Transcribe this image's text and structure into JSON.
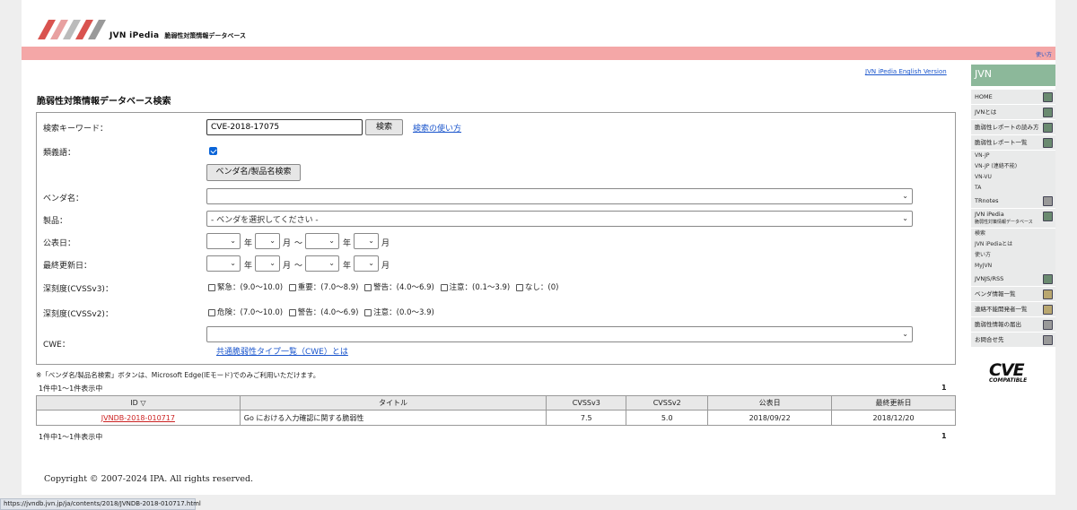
{
  "header": {
    "logo_name": "JVN iPedia",
    "logo_subtitle": "脆弱性対策情報データベース",
    "usage_link": "使い方",
    "english_link": "JVN iPedia English Version"
  },
  "search": {
    "section_title": "脆弱性対策情報データベース検索",
    "keyword_label": "検索キーワード：",
    "keyword_value": "CVE-2018-17075",
    "search_button": "検索",
    "howto_link": "検索の使い方",
    "synonym_label": "類義語：",
    "synonym_checked": true,
    "vendor_product_button": "ベンダ名/製品名検索",
    "vendor_label": "ベンダ名：",
    "vendor_value": "",
    "product_label": "製品：",
    "product_value": "- ベンダを選択してください -",
    "published_label": "公表日：",
    "updated_label": "最終更新日：",
    "unit_year": "年",
    "unit_month": "月",
    "range_sep": "〜",
    "cvss3_label": "深刻度(CVSSv3)：",
    "cvss3_options": [
      "緊急：(9.0〜10.0)",
      "重要：(7.0〜8.9)",
      "警告：(4.0〜6.9)",
      "注意：(0.1〜3.9)",
      "なし：(0)"
    ],
    "cvss2_label": "深刻度(CVSSv2)：",
    "cvss2_options": [
      "危険：(7.0〜10.0)",
      "警告：(4.0〜6.9)",
      "注意：(0.0〜3.9)"
    ],
    "cwe_label": "CWE：",
    "cwe_value": "",
    "cwe_link": "共通脆弱性タイプ一覧（CWE）とは"
  },
  "results": {
    "note": "※「ベンダ名/製品名検索」ボタンは、Microsoft Edge(IEモード)でのみご利用いただけます。",
    "count_text": "1件中1〜1件表示中",
    "page_number": "1",
    "columns": [
      "ID ▽",
      "タイトル",
      "CVSSv3",
      "CVSSv2",
      "公表日",
      "最終更新日"
    ],
    "rows": [
      [
        "JVNDB-2018-010717",
        "Go における入力確認に関する脆弱性",
        "7.5",
        "5.0",
        "2018/09/22",
        "2018/12/20"
      ]
    ]
  },
  "footer": {
    "copyright": "Copyright © 2007-2024 IPA. All rights reserved."
  },
  "sidebar": {
    "head": "JVN",
    "items": [
      {
        "label": "HOME",
        "icon": "home-icon",
        "sub": false
      },
      {
        "label": "JVNとは",
        "icon": "info-icon",
        "sub": false
      },
      {
        "label": "脆弱性レポートの読み方",
        "icon": "document-icon",
        "sub": false
      },
      {
        "label": "脆弱性レポート一覧",
        "icon": "list-icon",
        "sub": false
      },
      {
        "label": "VN-JP",
        "sub": true
      },
      {
        "label": "VN-JP (連絡不能)",
        "sub": true
      },
      {
        "label": "VN-VU",
        "sub": true
      },
      {
        "label": "TA",
        "sub": true
      },
      {
        "label": "TRnotes",
        "icon": "pin-icon",
        "sub": false
      },
      {
        "label": "JVN iPedia",
        "label2": "脆弱性対策情報データベース",
        "icon": "database-icon",
        "sub": false
      },
      {
        "label": "検索",
        "sub": true
      },
      {
        "label": "JVN iPediaとは",
        "sub": true
      },
      {
        "label": "使い方",
        "sub": true
      },
      {
        "label": "MyJVN",
        "sub": true
      },
      {
        "label": "JVNJS/RSS",
        "icon": "feed-icon",
        "sub": false
      },
      {
        "label": "ベンダ情報一覧",
        "icon": "vendor-icon",
        "sub": false
      },
      {
        "label": "連絡不能開発者一覧",
        "icon": "contact-icon",
        "sub": false
      },
      {
        "label": "脆弱性情報の届出",
        "icon": "report-icon",
        "sub": false
      },
      {
        "label": "お問合せ先",
        "icon": "phone-icon",
        "sub": false
      }
    ],
    "cve_logo_text": "CVE",
    "cve_logo_sub": "COMPATIBLE"
  },
  "statusbar": {
    "url": "https://jvndb.jvn.jp/ja/contents/2018/JVNDB-2018-010717.html"
  }
}
